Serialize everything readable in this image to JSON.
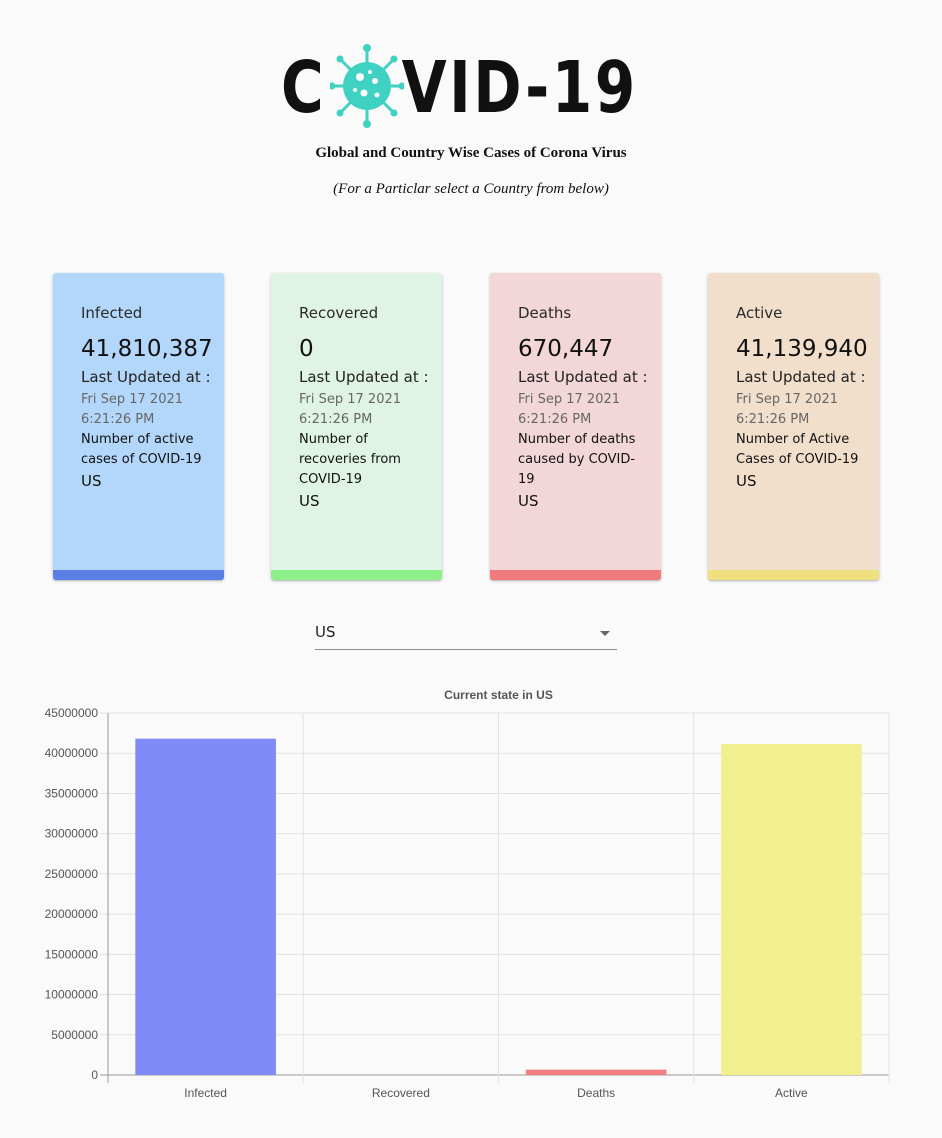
{
  "header": {
    "logo_text": "COVID-19",
    "subtitle": "Global and Country Wise Cases of Corona Virus",
    "instruction": "(For a Particlar select a Country from below)"
  },
  "cards": [
    {
      "title": "Infected",
      "value": "41,810,387",
      "last_updated_label": "Last Updated at :",
      "date": "Fri Sep 17 2021 6:21:26 PM",
      "description": "Number of active cases of COVID-19",
      "country": "US",
      "color": "#b3d7fb",
      "accent": "#5b7fe6"
    },
    {
      "title": "Recovered",
      "value": "0",
      "last_updated_label": "Last Updated at :",
      "date": "Fri Sep 17 2021 6:21:26 PM",
      "description": "Number of recoveries from COVID-19",
      "country": "US",
      "color": "#dff4e4",
      "accent": "#8ef08b"
    },
    {
      "title": "Deaths",
      "value": "670,447",
      "last_updated_label": "Last Updated at :",
      "date": "Fri Sep 17 2021 6:21:26 PM",
      "description": "Number of deaths caused by COVID-19",
      "country": "US",
      "color": "#f2d6d8",
      "accent": "#f07a7c"
    },
    {
      "title": "Active",
      "value": "41,139,940",
      "last_updated_label": "Last Updated at :",
      "date": "Fri Sep 17 2021 6:21:26 PM",
      "description": "Number of Active Cases of COVID-19",
      "country": "US",
      "color": "#f2dfcb",
      "accent": "#f0df7f"
    }
  ],
  "country_select": {
    "selected": "US"
  },
  "chart_data": {
    "type": "bar",
    "title": "Current state in US",
    "categories": [
      "Infected",
      "Recovered",
      "Deaths",
      "Active"
    ],
    "values": [
      41810387,
      0,
      670447,
      41139940
    ],
    "colors": [
      "#7f8bf8",
      "#8ef08b",
      "#f37f80",
      "#f2ef8f"
    ],
    "ylim": [
      0,
      45000000
    ],
    "yticks": [
      "0",
      "5000000",
      "10000000",
      "15000000",
      "20000000",
      "25000000",
      "30000000",
      "35000000",
      "40000000",
      "45000000"
    ],
    "grid": true,
    "legend": false
  }
}
